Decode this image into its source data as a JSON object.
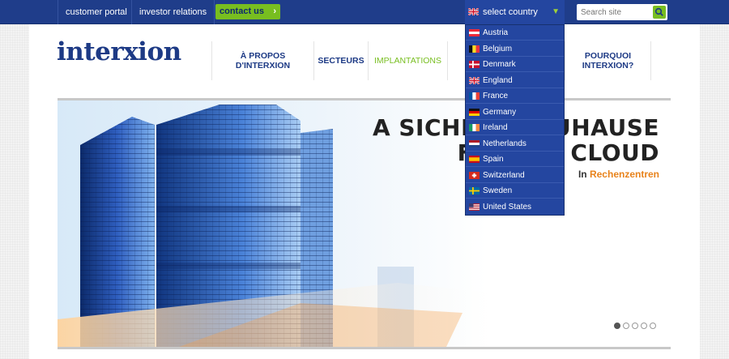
{
  "topbar": {
    "customer_portal": "customer portal",
    "investor_relations": "investor relations",
    "contact_us": "contact us",
    "country_label": "select country",
    "search_placeholder": "Search site"
  },
  "logo": "interxion",
  "nav": [
    {
      "label": "À PROPOS D'INTERXION",
      "active": false
    },
    {
      "label": "SECTEURS",
      "active": false
    },
    {
      "label": "IMPLANTATIONS",
      "active": true
    },
    {
      "label": "POURQUOI INTERXION?",
      "active": false
    }
  ],
  "hero": {
    "line1": "A SICHERES ZUHAUSE",
    "line2": "FÜR DIE CLOUD",
    "sub_prefix": "In ",
    "sub_highlight": "Rechenzentren",
    "slides": 5,
    "active_slide": 1
  },
  "countries": [
    {
      "name": "Austria",
      "flag": "austria-flag-icon"
    },
    {
      "name": "Belgium",
      "flag": "belgium-flag-icon"
    },
    {
      "name": "Denmark",
      "flag": "denmark-flag-icon"
    },
    {
      "name": "England",
      "flag": "uk-flag-icon"
    },
    {
      "name": "France",
      "flag": "france-flag-icon"
    },
    {
      "name": "Germany",
      "flag": "germany-flag-icon"
    },
    {
      "name": "Ireland",
      "flag": "ireland-flag-icon"
    },
    {
      "name": "Netherlands",
      "flag": "netherlands-flag-icon"
    },
    {
      "name": "Spain",
      "flag": "spain-flag-icon"
    },
    {
      "name": "Switzerland",
      "flag": "switzerland-flag-icon"
    },
    {
      "name": "Sweden",
      "flag": "sweden-flag-icon"
    },
    {
      "name": "United States",
      "flag": "usa-flag-icon"
    }
  ],
  "colors": {
    "brand_blue": "#1f3d8a",
    "accent_green": "#78be20",
    "accent_orange": "#e8821a"
  }
}
